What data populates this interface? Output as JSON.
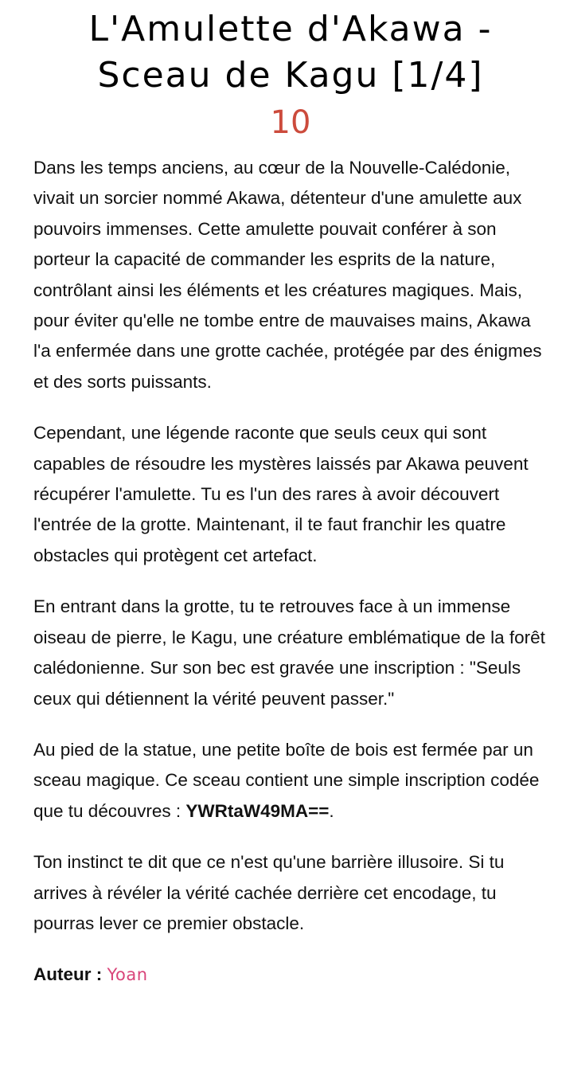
{
  "challenge": {
    "title_line1": "L'Amulette d'Akawa -",
    "title_line2": "Sceau de Kagu [1/4]",
    "points": "10",
    "accent_color": "#cc4b3c"
  },
  "description": {
    "p1": "Dans les temps anciens, au cœur de la Nouvelle-Calédonie, vivait un sorcier nommé Akawa, détenteur d'une amulette aux pouvoirs immenses. Cette amulette pouvait conférer à son porteur la capacité de commander les esprits de la nature, contrôlant ainsi les éléments et les créatures magiques. Mais, pour éviter qu'elle ne tombe entre de mauvaises mains, Akawa l'a enfermée dans une grotte cachée, protégée par des énigmes et des sorts puissants.",
    "p2": "Cependant, une légende raconte que seuls ceux qui sont capables de résoudre les mystères laissés par Akawa peuvent récupérer l'amulette. Tu es l'un des rares à avoir découvert l'entrée de la grotte. Maintenant, il te faut franchir les quatre obstacles qui protègent cet artefact.",
    "p3": "En entrant dans la grotte, tu te retrouves face à un immense oiseau de pierre, le Kagu, une créature emblématique de la forêt calédonienne. Sur son bec est gravée une inscription : \"Seuls ceux qui détiennent la vérité peuvent passer.\"",
    "p4_before": "Au pied de la statue, une petite boîte de bois est fermée par un sceau magique. Ce sceau contient une simple inscription codée que tu découvres : ",
    "p4_code": "YWRtaW49MA==",
    "p4_after": ".",
    "p5": "Ton instinct te dit que ce n'est qu'une barrière illusoire. Si tu arrives à révéler la vérité cachée derrière cet encodage, tu pourras lever ce premier obstacle."
  },
  "author": {
    "label": "Auteur :",
    "name": "Yoan",
    "name_color": "#d9457a"
  }
}
